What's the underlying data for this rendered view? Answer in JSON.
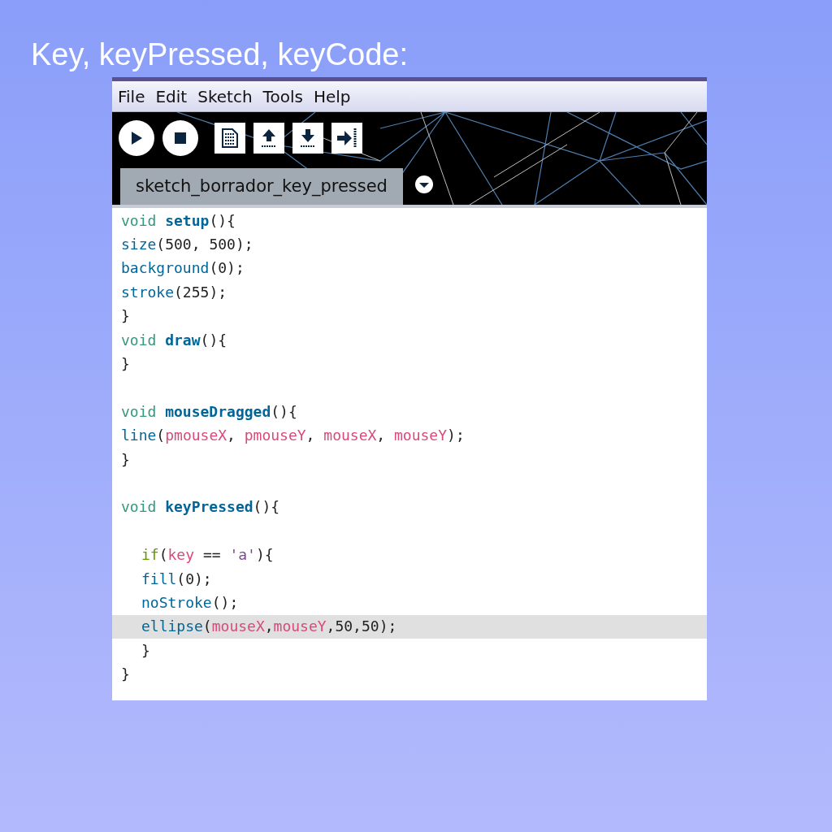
{
  "slide_title": "Key, keyPressed, keyCode:",
  "menu": [
    "File",
    "Edit",
    "Sketch",
    "Tools",
    "Help"
  ],
  "toolbar": [
    {
      "kind": "run"
    },
    {
      "kind": "stop"
    },
    {
      "kind": "new"
    },
    {
      "kind": "open"
    },
    {
      "kind": "save"
    },
    {
      "kind": "export"
    }
  ],
  "tab": {
    "label": "sketch_borrador_key_pressed",
    "selected": true
  },
  "code_lines": [
    {
      "highlighted": false,
      "tokens": [
        {
          "kind": "keyword",
          "text": "void "
        },
        {
          "kind": "function",
          "text": "setup"
        },
        {
          "kind": "plain",
          "text": "(){"
        }
      ]
    },
    {
      "highlighted": false,
      "tokens": [
        {
          "kind": "builtin",
          "text": "size"
        },
        {
          "kind": "plain",
          "text": "(500, 500);"
        }
      ]
    },
    {
      "highlighted": false,
      "tokens": [
        {
          "kind": "builtin",
          "text": "background"
        },
        {
          "kind": "plain",
          "text": "(0);"
        }
      ]
    },
    {
      "highlighted": false,
      "tokens": [
        {
          "kind": "builtin",
          "text": "stroke"
        },
        {
          "kind": "plain",
          "text": "(255);"
        }
      ]
    },
    {
      "highlighted": false,
      "tokens": [
        {
          "kind": "plain",
          "text": "}"
        }
      ]
    },
    {
      "highlighted": false,
      "tokens": [
        {
          "kind": "keyword",
          "text": "void "
        },
        {
          "kind": "function",
          "text": "draw"
        },
        {
          "kind": "plain",
          "text": "(){"
        }
      ]
    },
    {
      "highlighted": false,
      "tokens": [
        {
          "kind": "plain",
          "text": "}"
        }
      ]
    },
    {
      "highlighted": false
    },
    {
      "highlighted": false,
      "tokens": [
        {
          "kind": "keyword",
          "text": "void "
        },
        {
          "kind": "function",
          "text": "mouseDragged"
        },
        {
          "kind": "plain",
          "text": "(){"
        }
      ]
    },
    {
      "highlighted": false,
      "tokens": [
        {
          "kind": "builtin",
          "text": "line"
        },
        {
          "kind": "plain",
          "text": "("
        },
        {
          "kind": "variable",
          "text": "pmouseX"
        },
        {
          "kind": "plain",
          "text": ", "
        },
        {
          "kind": "variable",
          "text": "pmouseY"
        },
        {
          "kind": "plain",
          "text": ", "
        },
        {
          "kind": "variable",
          "text": "mouseX"
        },
        {
          "kind": "plain",
          "text": ", "
        },
        {
          "kind": "variable",
          "text": "mouseY"
        },
        {
          "kind": "plain",
          "text": ");"
        }
      ]
    },
    {
      "highlighted": false,
      "tokens": [
        {
          "kind": "plain",
          "text": "}"
        }
      ]
    },
    {
      "highlighted": false
    },
    {
      "highlighted": false,
      "tokens": [
        {
          "kind": "keyword",
          "text": "void "
        },
        {
          "kind": "function",
          "text": "keyPressed"
        },
        {
          "kind": "plain",
          "text": "(){"
        }
      ]
    },
    {
      "highlighted": false
    },
    {
      "highlighted": false,
      "indented": true,
      "tokens": [
        {
          "kind": "control",
          "text": "if"
        },
        {
          "kind": "plain",
          "text": "("
        },
        {
          "kind": "variable",
          "text": "key"
        },
        {
          "kind": "plain",
          "text": " == "
        },
        {
          "kind": "string",
          "text": "'a'"
        },
        {
          "kind": "plain",
          "text": "){"
        }
      ]
    },
    {
      "highlighted": false,
      "indented": true,
      "tokens": [
        {
          "kind": "builtin",
          "text": "fill"
        },
        {
          "kind": "plain",
          "text": "(0);"
        }
      ]
    },
    {
      "highlighted": false,
      "indented": true,
      "tokens": [
        {
          "kind": "builtin",
          "text": "noStroke"
        },
        {
          "kind": "plain",
          "text": "();"
        }
      ]
    },
    {
      "highlighted": true,
      "indented": true,
      "tokens": [
        {
          "kind": "builtin",
          "text": "ellipse"
        },
        {
          "kind": "plain",
          "text": "("
        },
        {
          "kind": "variable",
          "text": "mouseX"
        },
        {
          "kind": "plain",
          "text": ","
        },
        {
          "kind": "variable",
          "text": "mouseY"
        },
        {
          "kind": "plain",
          "text": ",50,50);"
        }
      ]
    },
    {
      "highlighted": false,
      "indented": true,
      "tokens": [
        {
          "kind": "plain",
          "text": "}"
        }
      ]
    },
    {
      "highlighted": false,
      "tokens": [
        {
          "kind": "plain",
          "text": "}"
        }
      ]
    }
  ]
}
